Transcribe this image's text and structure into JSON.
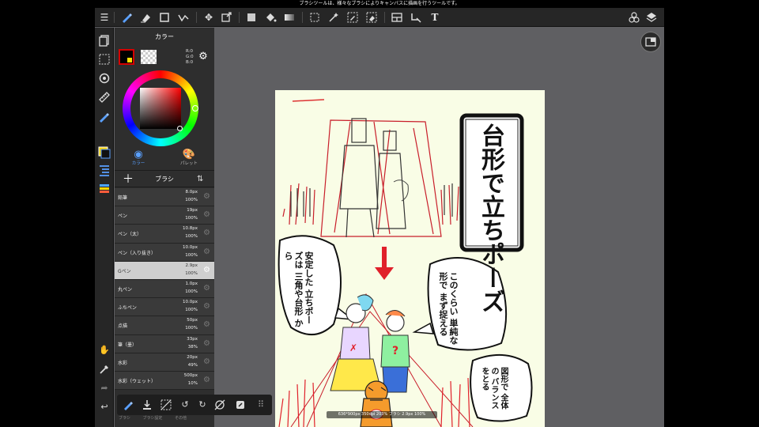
{
  "status_bar": {
    "text": "ブラシツールは、様々なブラシによりキャンバスに描画を行うツールです。"
  },
  "toolbar": {
    "icons": [
      "menu-icon",
      "brush-icon",
      "eraser-icon",
      "shape-icon",
      "transform-icon",
      "move-icon",
      "transform-box-icon",
      "fill-rect-icon",
      "bucket-icon",
      "gradient-icon",
      "select-rect-icon",
      "magic-wand-icon",
      "select-pen-icon",
      "select-eraser-icon",
      "panel-layout-icon",
      "snap-icon",
      "text-icon",
      "materials-icon",
      "layers-icon"
    ]
  },
  "color_panel": {
    "title": "カラー",
    "rgb": {
      "r": "R:0",
      "g": "G:0",
      "b": "B:0"
    },
    "foreground": "#000000",
    "tabs": [
      {
        "label": "カラー"
      },
      {
        "label": "パレット"
      }
    ]
  },
  "brush_panel": {
    "title": "ブラシ",
    "items": [
      {
        "name": "鉛筆",
        "size": "8.0px",
        "opacity": "100%"
      },
      {
        "name": "ペン",
        "size": "19px",
        "opacity": "100%"
      },
      {
        "name": "ペン（太）",
        "size": "10.8px",
        "opacity": "100%"
      },
      {
        "name": "ペン（入り抜き）",
        "size": "10.0px",
        "opacity": "100%"
      },
      {
        "name": "Gペン",
        "size": "2.9px",
        "opacity": "100%"
      },
      {
        "name": "丸ペン",
        "size": "1.0px",
        "opacity": "100%"
      },
      {
        "name": "ふちペン",
        "size": "10.0px",
        "opacity": "100%"
      },
      {
        "name": "点描",
        "size": "50px",
        "opacity": "100%"
      },
      {
        "name": "筆（墨）",
        "size": "33px",
        "opacity": "38%"
      },
      {
        "name": "水彩",
        "size": "20px",
        "opacity": "49%"
      },
      {
        "name": "水彩（ウェット）",
        "size": "500px",
        "opacity": "10%"
      }
    ],
    "selected_index": 4
  },
  "bottom_labels": [
    "ブラシ",
    "ブラシ設定",
    "その他"
  ],
  "canvas_info": "636*900px 350dpi 203% ブラシ 2.9px 100%",
  "canvas_text": {
    "title": "台形で立ちポーズ",
    "bubble_left": [
      "安定した",
      "立ちポーズは",
      "三角や台形",
      "から"
    ],
    "bubble_right": [
      "このくらい",
      "単純な",
      "形で",
      "まず捉える"
    ],
    "bubble_bottom": [
      "図形で",
      "全体の",
      "バランス",
      "をとる"
    ]
  },
  "colors": {
    "accent_red": "#e0202a",
    "paper": "#f9fde6",
    "app_bg": "#5f5f62",
    "panel_bg": "#2e2e2e",
    "selected_row": "#cfcfcf"
  }
}
